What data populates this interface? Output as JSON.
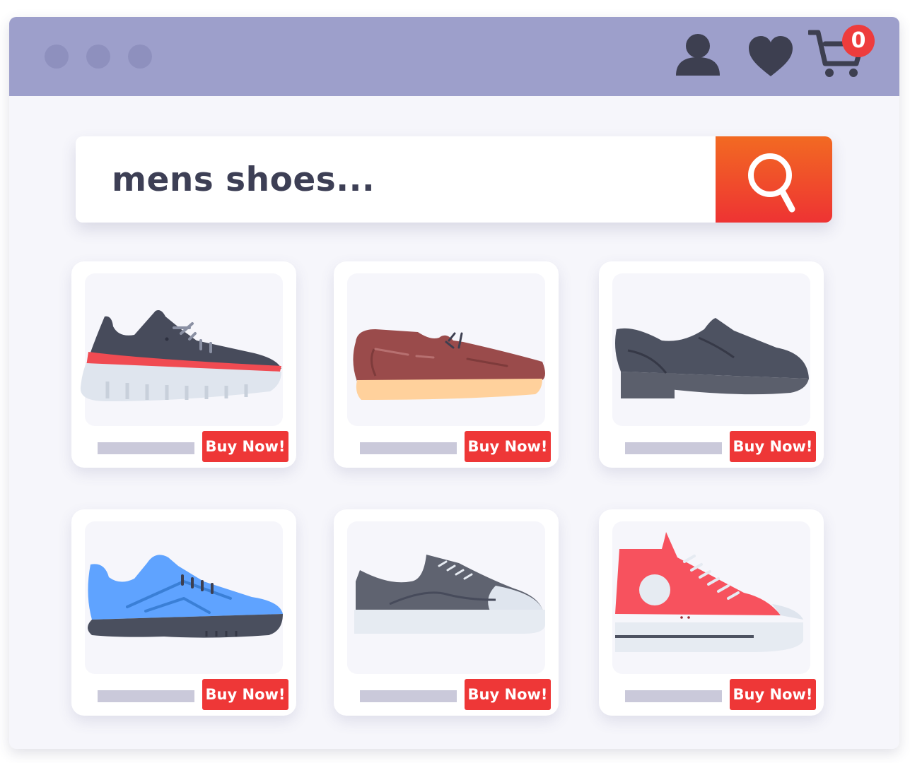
{
  "window": {
    "controls": [
      "close",
      "minimize",
      "maximize"
    ]
  },
  "header": {
    "icons": [
      "user-icon",
      "heart-icon",
      "cart-icon"
    ],
    "cart_count": "0"
  },
  "search": {
    "placeholder": "mens shoes...",
    "button_icon": "search-icon"
  },
  "products": [
    {
      "buy_label": "Buy Now!",
      "icon": "sneaker-icon",
      "colors": [
        "#474b5b",
        "#f04b52",
        "#dfe5ee"
      ]
    },
    {
      "buy_label": "Buy Now!",
      "icon": "loafer-icon",
      "colors": [
        "#9a4b4b",
        "#ffd19c"
      ]
    },
    {
      "buy_label": "Buy Now!",
      "icon": "dress-shoe-icon",
      "colors": [
        "#4d5261",
        "#5b5f6c"
      ]
    },
    {
      "buy_label": "Buy Now!",
      "icon": "running-shoe-icon",
      "colors": [
        "#5fa3ff",
        "#4a4f5e"
      ]
    },
    {
      "buy_label": "Buy Now!",
      "icon": "canvas-sneaker-icon",
      "colors": [
        "#5f6370",
        "#dfe5ee"
      ]
    },
    {
      "buy_label": "Buy Now!",
      "icon": "high-top-sneaker-icon",
      "colors": [
        "#f7525e",
        "#dfe5ee"
      ]
    }
  ],
  "colors": {
    "titlebar": "#9d9fcb",
    "accent": "#ee3737",
    "search_button": "#f26a22",
    "icon": "#3d3f50"
  }
}
